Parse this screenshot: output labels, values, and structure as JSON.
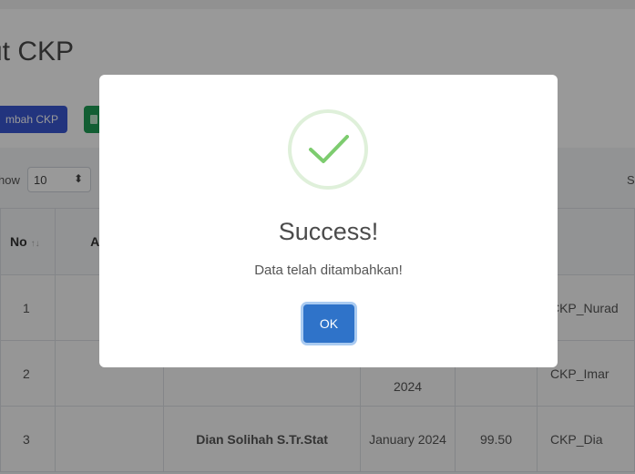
{
  "page": {
    "title": "ut CKP",
    "add_button_label": "mbah CKP",
    "export_icon": "file-excel-icon",
    "show_label": "how",
    "page_size": "10",
    "search_label": "S"
  },
  "table": {
    "headers": {
      "no": "No",
      "col_a": "A"
    },
    "sort_icon": "↑↓",
    "rows": [
      {
        "no": "1",
        "name": "",
        "month": "",
        "score": "",
        "file": "CKP_Nurad"
      },
      {
        "no": "2",
        "name": "",
        "month": "2024",
        "score": "",
        "file": "CKP_Imar"
      },
      {
        "no": "3",
        "name": "Dian Solihah S.Tr.Stat",
        "month": "January 2024",
        "score": "99.50",
        "file": "CKP_Dia"
      }
    ]
  },
  "modal": {
    "icon": "success-check-icon",
    "title": "Success!",
    "message": "Data telah ditambahkan!",
    "ok_label": "OK"
  },
  "colors": {
    "accent": "#3a57d3",
    "ok_button": "#2f73c9",
    "success_green": "#7dcc6f",
    "link": "#3a6bd8"
  }
}
